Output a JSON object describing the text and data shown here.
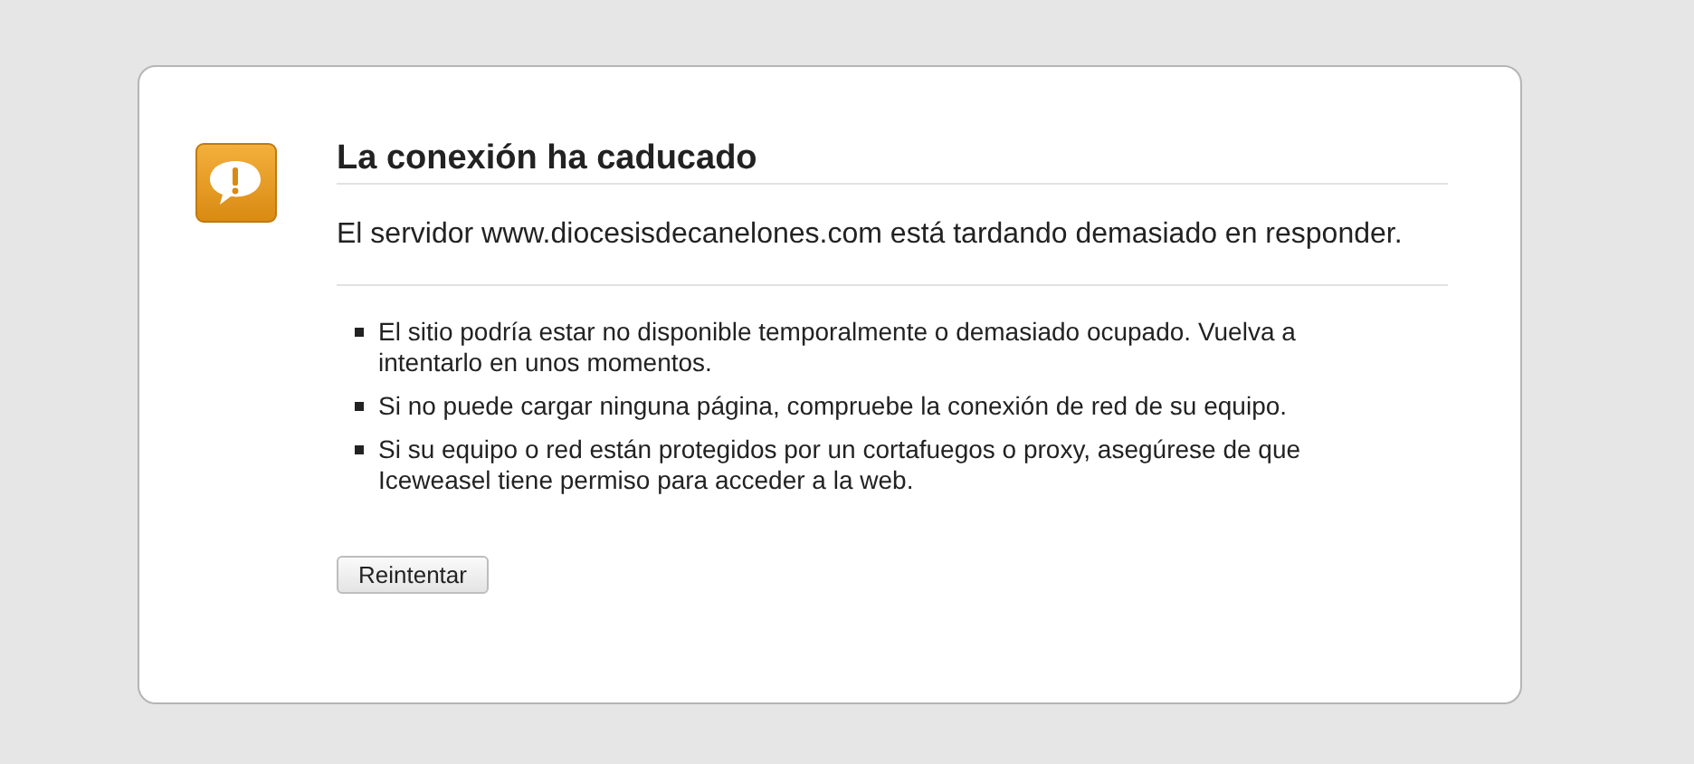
{
  "title": "La conexión ha caducado",
  "message": "El servidor www.diocesisdecanelones.com está tardando demasiado en responder.",
  "suggestions": [
    "El sitio podría estar no disponible temporalmente o demasiado ocupado. Vuelva a intentarlo en unos momentos.",
    "Si no puede cargar ninguna página, compruebe la conexión de red de su equipo.",
    "Si su equipo o red están protegidos por un cortafuegos o proxy, asegúrese de que Iceweasel tiene permiso para acceder a la web."
  ],
  "button": "Reintentar"
}
